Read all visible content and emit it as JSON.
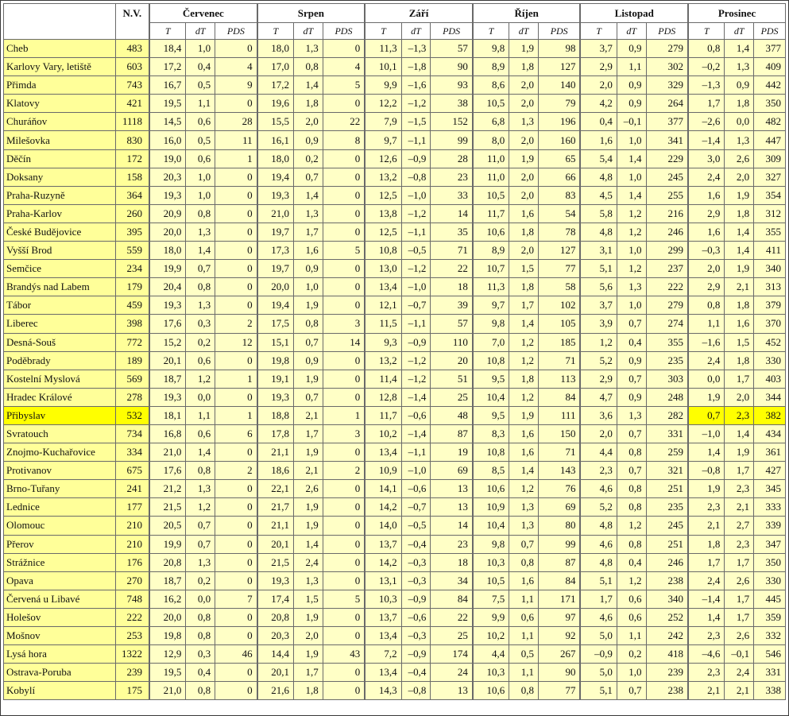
{
  "header": {
    "elevation": "N.V.",
    "months": [
      "Červenec",
      "Srpen",
      "Září",
      "Říjen",
      "Listopad",
      "Prosinec"
    ],
    "subcolumns": [
      "T",
      "dT",
      "PDS"
    ]
  },
  "highlight": {
    "station": "Přibyslav",
    "months_highlighted": [
      "Prosinec"
    ],
    "color": "#ffff00",
    "cell_color": "#ffffc6",
    "label_color": "#ffff99"
  },
  "rows": [
    {
      "name": "Cheb",
      "elev": "483",
      "vals": [
        "18,4",
        "1,0",
        "0",
        "18,0",
        "1,3",
        "0",
        "11,3",
        "–1,3",
        "57",
        "9,8",
        "1,9",
        "98",
        "3,7",
        "0,9",
        "279",
        "0,8",
        "1,4",
        "377"
      ]
    },
    {
      "name": "Karlovy Vary, letiště",
      "elev": "603",
      "vals": [
        "17,2",
        "0,4",
        "4",
        "17,0",
        "0,8",
        "4",
        "10,1",
        "–1,8",
        "90",
        "8,9",
        "1,8",
        "127",
        "2,9",
        "1,1",
        "302",
        "–0,2",
        "1,3",
        "409"
      ]
    },
    {
      "name": "Přimda",
      "elev": "743",
      "vals": [
        "16,7",
        "0,5",
        "9",
        "17,2",
        "1,4",
        "5",
        "9,9",
        "–1,6",
        "93",
        "8,6",
        "2,0",
        "140",
        "2,0",
        "0,9",
        "329",
        "–1,3",
        "0,9",
        "442"
      ]
    },
    {
      "name": "Klatovy",
      "elev": "421",
      "vals": [
        "19,5",
        "1,1",
        "0",
        "19,6",
        "1,8",
        "0",
        "12,2",
        "–1,2",
        "38",
        "10,5",
        "2,0",
        "79",
        "4,2",
        "0,9",
        "264",
        "1,7",
        "1,8",
        "350"
      ]
    },
    {
      "name": "Churáňov",
      "elev": "1118",
      "vals": [
        "14,5",
        "0,6",
        "28",
        "15,5",
        "2,0",
        "22",
        "7,9",
        "–1,5",
        "152",
        "6,8",
        "1,3",
        "196",
        "0,4",
        "–0,1",
        "377",
        "–2,6",
        "0,0",
        "482"
      ]
    },
    {
      "name": "Milešovka",
      "elev": "830",
      "vals": [
        "16,0",
        "0,5",
        "11",
        "16,1",
        "0,9",
        "8",
        "9,7",
        "–1,1",
        "99",
        "8,0",
        "2,0",
        "160",
        "1,6",
        "1,0",
        "341",
        "–1,4",
        "1,3",
        "447"
      ]
    },
    {
      "name": "Děčín",
      "elev": "172",
      "vals": [
        "19,0",
        "0,6",
        "1",
        "18,0",
        "0,2",
        "0",
        "12,6",
        "–0,9",
        "28",
        "11,0",
        "1,9",
        "65",
        "5,4",
        "1,4",
        "229",
        "3,0",
        "2,6",
        "309"
      ]
    },
    {
      "name": "Doksany",
      "elev": "158",
      "vals": [
        "20,3",
        "1,0",
        "0",
        "19,4",
        "0,7",
        "0",
        "13,2",
        "–0,8",
        "23",
        "11,0",
        "2,0",
        "66",
        "4,8",
        "1,0",
        "245",
        "2,4",
        "2,0",
        "327"
      ]
    },
    {
      "name": "Praha-Ruzyně",
      "elev": "364",
      "vals": [
        "19,3",
        "1,0",
        "0",
        "19,3",
        "1,4",
        "0",
        "12,5",
        "–1,0",
        "33",
        "10,5",
        "2,0",
        "83",
        "4,5",
        "1,4",
        "255",
        "1,6",
        "1,9",
        "354"
      ]
    },
    {
      "name": "Praha-Karlov",
      "elev": "260",
      "vals": [
        "20,9",
        "0,8",
        "0",
        "21,0",
        "1,3",
        "0",
        "13,8",
        "–1,2",
        "14",
        "11,7",
        "1,6",
        "54",
        "5,8",
        "1,2",
        "216",
        "2,9",
        "1,8",
        "312"
      ]
    },
    {
      "name": "České Budějovice",
      "elev": "395",
      "vals": [
        "20,0",
        "1,3",
        "0",
        "19,7",
        "1,7",
        "0",
        "12,5",
        "–1,1",
        "35",
        "10,6",
        "1,8",
        "78",
        "4,8",
        "1,2",
        "246",
        "1,6",
        "1,4",
        "355"
      ]
    },
    {
      "name": "Vyšší Brod",
      "elev": "559",
      "vals": [
        "18,0",
        "1,4",
        "0",
        "17,3",
        "1,6",
        "5",
        "10,8",
        "–0,5",
        "71",
        "8,9",
        "2,0",
        "127",
        "3,1",
        "1,0",
        "299",
        "–0,3",
        "1,4",
        "411"
      ]
    },
    {
      "name": "Semčice",
      "elev": "234",
      "vals": [
        "19,9",
        "0,7",
        "0",
        "19,7",
        "0,9",
        "0",
        "13,0",
        "–1,2",
        "22",
        "10,7",
        "1,5",
        "77",
        "5,1",
        "1,2",
        "237",
        "2,0",
        "1,9",
        "340"
      ]
    },
    {
      "name": "Brandýs nad Labem",
      "elev": "179",
      "vals": [
        "20,4",
        "0,8",
        "0",
        "20,0",
        "1,0",
        "0",
        "13,4",
        "–1,0",
        "18",
        "11,3",
        "1,8",
        "58",
        "5,6",
        "1,3",
        "222",
        "2,9",
        "2,1",
        "313"
      ]
    },
    {
      "name": "Tábor",
      "elev": "459",
      "vals": [
        "19,3",
        "1,3",
        "0",
        "19,4",
        "1,9",
        "0",
        "12,1",
        "–0,7",
        "39",
        "9,7",
        "1,7",
        "102",
        "3,7",
        "1,0",
        "279",
        "0,8",
        "1,8",
        "379"
      ]
    },
    {
      "name": "Liberec",
      "elev": "398",
      "vals": [
        "17,6",
        "0,3",
        "2",
        "17,5",
        "0,8",
        "3",
        "11,5",
        "–1,1",
        "57",
        "9,8",
        "1,4",
        "105",
        "3,9",
        "0,7",
        "274",
        "1,1",
        "1,6",
        "370"
      ]
    },
    {
      "name": "Desná-Souš",
      "elev": "772",
      "vals": [
        "15,2",
        "0,2",
        "12",
        "15,1",
        "0,7",
        "14",
        "9,3",
        "–0,9",
        "110",
        "7,0",
        "1,2",
        "185",
        "1,2",
        "0,4",
        "355",
        "–1,6",
        "1,5",
        "452"
      ]
    },
    {
      "name": "Poděbrady",
      "elev": "189",
      "vals": [
        "20,1",
        "0,6",
        "0",
        "19,8",
        "0,9",
        "0",
        "13,2",
        "–1,2",
        "20",
        "10,8",
        "1,2",
        "71",
        "5,2",
        "0,9",
        "235",
        "2,4",
        "1,8",
        "330"
      ]
    },
    {
      "name": "Kostelní Myslová",
      "elev": "569",
      "vals": [
        "18,7",
        "1,2",
        "1",
        "19,1",
        "1,9",
        "0",
        "11,4",
        "–1,2",
        "51",
        "9,5",
        "1,8",
        "113",
        "2,9",
        "0,7",
        "303",
        "0,0",
        "1,7",
        "403"
      ]
    },
    {
      "name": "Hradec Králové",
      "elev": "278",
      "vals": [
        "19,3",
        "0,0",
        "0",
        "19,3",
        "0,7",
        "0",
        "12,8",
        "–1,4",
        "25",
        "10,4",
        "1,2",
        "84",
        "4,7",
        "0,9",
        "248",
        "1,9",
        "2,0",
        "344"
      ]
    },
    {
      "name": "Přibyslav",
      "elev": "532",
      "vals": [
        "18,1",
        "1,1",
        "1",
        "18,8",
        "2,1",
        "1",
        "11,7",
        "–0,6",
        "48",
        "9,5",
        "1,9",
        "111",
        "3,6",
        "1,3",
        "282",
        "0,7",
        "2,3",
        "382"
      ],
      "highlight": true
    },
    {
      "name": "Svratouch",
      "elev": "734",
      "vals": [
        "16,8",
        "0,6",
        "6",
        "17,8",
        "1,7",
        "3",
        "10,2",
        "–1,4",
        "87",
        "8,3",
        "1,6",
        "150",
        "2,0",
        "0,7",
        "331",
        "–1,0",
        "1,4",
        "434"
      ]
    },
    {
      "name": "Znojmo-Kuchařovice",
      "elev": "334",
      "vals": [
        "21,0",
        "1,4",
        "0",
        "21,1",
        "1,9",
        "0",
        "13,4",
        "–1,1",
        "19",
        "10,8",
        "1,6",
        "71",
        "4,4",
        "0,8",
        "259",
        "1,4",
        "1,9",
        "361"
      ]
    },
    {
      "name": "Protivanov",
      "elev": "675",
      "vals": [
        "17,6",
        "0,8",
        "2",
        "18,6",
        "2,1",
        "2",
        "10,9",
        "–1,0",
        "69",
        "8,5",
        "1,4",
        "143",
        "2,3",
        "0,7",
        "321",
        "–0,8",
        "1,7",
        "427"
      ]
    },
    {
      "name": "Brno-Tuřany",
      "elev": "241",
      "vals": [
        "21,2",
        "1,3",
        "0",
        "22,1",
        "2,6",
        "0",
        "14,1",
        "–0,6",
        "13",
        "10,6",
        "1,2",
        "76",
        "4,6",
        "0,8",
        "251",
        "1,9",
        "2,3",
        "345"
      ]
    },
    {
      "name": "Lednice",
      "elev": "177",
      "vals": [
        "21,5",
        "1,2",
        "0",
        "21,7",
        "1,9",
        "0",
        "14,2",
        "–0,7",
        "13",
        "10,9",
        "1,3",
        "69",
        "5,2",
        "0,8",
        "235",
        "2,3",
        "2,1",
        "333"
      ]
    },
    {
      "name": "Olomouc",
      "elev": "210",
      "vals": [
        "20,5",
        "0,7",
        "0",
        "21,1",
        "1,9",
        "0",
        "14,0",
        "–0,5",
        "14",
        "10,4",
        "1,3",
        "80",
        "4,8",
        "1,2",
        "245",
        "2,1",
        "2,7",
        "339"
      ]
    },
    {
      "name": "Přerov",
      "elev": "210",
      "vals": [
        "19,9",
        "0,7",
        "0",
        "20,1",
        "1,4",
        "0",
        "13,7",
        "–0,4",
        "23",
        "9,8",
        "0,7",
        "99",
        "4,6",
        "0,8",
        "251",
        "1,8",
        "2,3",
        "347"
      ]
    },
    {
      "name": "Strážnice",
      "elev": "176",
      "vals": [
        "20,8",
        "1,3",
        "0",
        "21,5",
        "2,4",
        "0",
        "14,2",
        "–0,3",
        "18",
        "10,3",
        "0,8",
        "87",
        "4,8",
        "0,4",
        "246",
        "1,7",
        "1,7",
        "350"
      ]
    },
    {
      "name": "Opava",
      "elev": "270",
      "vals": [
        "18,7",
        "0,2",
        "0",
        "19,3",
        "1,3",
        "0",
        "13,1",
        "–0,3",
        "34",
        "10,5",
        "1,6",
        "84",
        "5,1",
        "1,2",
        "238",
        "2,4",
        "2,6",
        "330"
      ]
    },
    {
      "name": "Červená u Libavé",
      "elev": "748",
      "vals": [
        "16,2",
        "0,0",
        "7",
        "17,4",
        "1,5",
        "5",
        "10,3",
        "–0,9",
        "84",
        "7,5",
        "1,1",
        "171",
        "1,7",
        "0,6",
        "340",
        "–1,4",
        "1,7",
        "445"
      ]
    },
    {
      "name": "Holešov",
      "elev": "222",
      "vals": [
        "20,0",
        "0,8",
        "0",
        "20,8",
        "1,9",
        "0",
        "13,7",
        "–0,6",
        "22",
        "9,9",
        "0,6",
        "97",
        "4,6",
        "0,6",
        "252",
        "1,4",
        "1,7",
        "359"
      ]
    },
    {
      "name": "Mošnov",
      "elev": "253",
      "vals": [
        "19,8",
        "0,8",
        "0",
        "20,3",
        "2,0",
        "0",
        "13,4",
        "–0,3",
        "25",
        "10,2",
        "1,1",
        "92",
        "5,0",
        "1,1",
        "242",
        "2,3",
        "2,6",
        "332"
      ]
    },
    {
      "name": "Lysá hora",
      "elev": "1322",
      "vals": [
        "12,9",
        "0,3",
        "46",
        "14,4",
        "1,9",
        "43",
        "7,2",
        "–0,9",
        "174",
        "4,4",
        "0,5",
        "267",
        "–0,9",
        "0,2",
        "418",
        "–4,6",
        "–0,1",
        "546"
      ]
    },
    {
      "name": "Ostrava-Poruba",
      "elev": "239",
      "vals": [
        "19,5",
        "0,4",
        "0",
        "20,1",
        "1,7",
        "0",
        "13,4",
        "–0,4",
        "24",
        "10,3",
        "1,1",
        "90",
        "5,0",
        "1,0",
        "239",
        "2,3",
        "2,4",
        "331"
      ]
    },
    {
      "name": "Kobylí",
      "elev": "175",
      "vals": [
        "21,0",
        "0,8",
        "0",
        "21,6",
        "1,8",
        "0",
        "14,3",
        "–0,8",
        "13",
        "10,6",
        "0,8",
        "77",
        "5,1",
        "0,7",
        "238",
        "2,1",
        "2,1",
        "338"
      ]
    }
  ]
}
